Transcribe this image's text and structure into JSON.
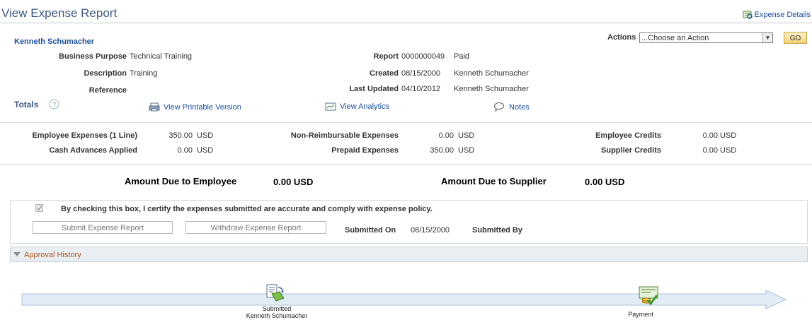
{
  "header": {
    "title": "View Expense Report",
    "expense_details_link": "Expense Details"
  },
  "employee_name": "Kenneth Schumacher",
  "actions": {
    "label": "Actions",
    "selected": "...Choose an Action",
    "go_label": "GO"
  },
  "info": {
    "business_purpose_label": "Business Purpose",
    "business_purpose": "Technical Training",
    "description_label": "Description",
    "description": "Training",
    "reference_label": "Reference",
    "report_label": "Report",
    "report_id": "0000000049",
    "report_status": "Paid",
    "created_label": "Created",
    "created_date": "08/15/2000",
    "created_by": "Kenneth Schumacher",
    "updated_label": "Last Updated",
    "updated_date": "04/10/2012",
    "updated_by": "Kenneth Schumacher"
  },
  "totals": {
    "label": "Totals",
    "printable": "View Printable Version",
    "analytics": "View Analytics",
    "notes": "Notes"
  },
  "amounts": {
    "emp_exp_label": "Employee Expenses (1 Line)",
    "emp_exp": "350.00",
    "emp_exp_cur": "USD",
    "cash_adv_label": "Cash Advances Applied",
    "cash_adv": "0.00",
    "cash_adv_cur": "USD",
    "nonreimb_label": "Non-Reimbursable Expenses",
    "nonreimb": "0.00",
    "nonreimb_cur": "USD",
    "prepaid_label": "Prepaid Expenses",
    "prepaid": "350.00",
    "prepaid_cur": "USD",
    "emp_credits_label": "Employee Credits",
    "emp_credits": "0.00",
    "emp_credits_cur": "USD",
    "sup_credits_label": "Supplier Credits",
    "sup_credits": "0.00",
    "sup_credits_cur": "USD"
  },
  "due": {
    "employee_label": "Amount Due to Employee",
    "employee_amount": "0.00  USD",
    "supplier_label": "Amount Due to Supplier",
    "supplier_amount": "0.00  USD"
  },
  "certify": {
    "text": "By checking this box, I certify the expenses submitted are accurate and comply with expense policy.",
    "checked": true
  },
  "actions_row": {
    "submit": "Submit Expense Report",
    "withdraw": "Withdraw Expense Report",
    "submitted_on_label": "Submitted On",
    "submitted_on": "08/15/2000",
    "submitted_by_label": "Submitted By"
  },
  "approval": {
    "label": "Approval History"
  },
  "flow": {
    "step1_title": "Submitted",
    "step1_name": "Kenneth Schumacher",
    "step2_title": "Payment"
  }
}
